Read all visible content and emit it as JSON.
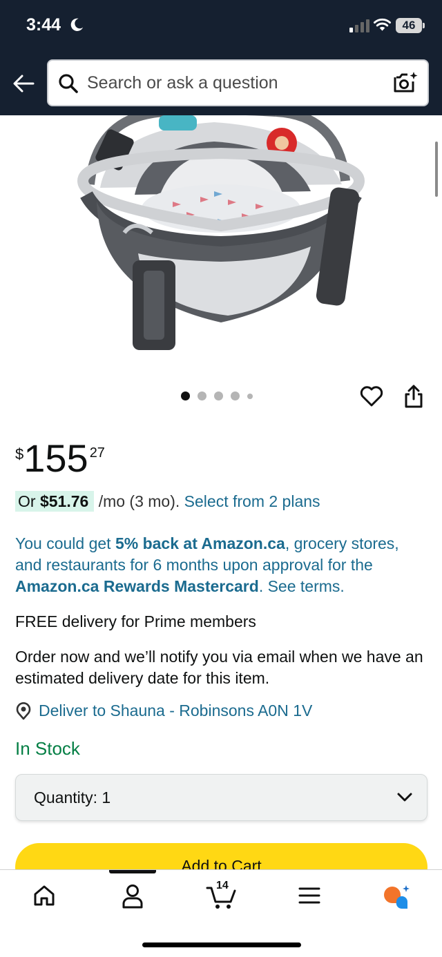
{
  "status_bar": {
    "time": "3:44",
    "battery": "46"
  },
  "search": {
    "placeholder": "Search or ask a question"
  },
  "product": {
    "image_icon": "baby-dome-bassinet-image",
    "carousel": {
      "total": 5,
      "active_index": 0
    }
  },
  "price": {
    "currency_symbol": "$",
    "whole": "155",
    "fraction": "27"
  },
  "installment": {
    "prefix": "Or ",
    "amount": "$51.76",
    "period": "/mo (3 mo).",
    "link": "Select from 2 plans"
  },
  "promo": {
    "part1": "You could get ",
    "bold1": "5% back at Amazon.ca",
    "part2": ", grocery stores, and restaurants for 6 months upon approval for the ",
    "bold2": "Amazon.ca Rewards Mastercard",
    "part3": ". See terms."
  },
  "delivery": {
    "free_text": "FREE delivery for Prime members",
    "order_text": "Order now and we’ll notify you via email when we have an estimated delivery date for this item.",
    "deliver_to": "Deliver to Shauna - Robinsons A0N 1V"
  },
  "stock": {
    "status": "In Stock"
  },
  "quantity": {
    "label": "Quantity: 1"
  },
  "buttons": {
    "add_to_cart": "Add to Cart"
  },
  "bottom_nav": {
    "cart_count": "14"
  },
  "colors": {
    "header_bg": "#152030",
    "link": "#1b6b8f",
    "in_stock": "#057f45",
    "cart_button": "#ffd814",
    "installment_highlight": "#d8f4ea"
  }
}
